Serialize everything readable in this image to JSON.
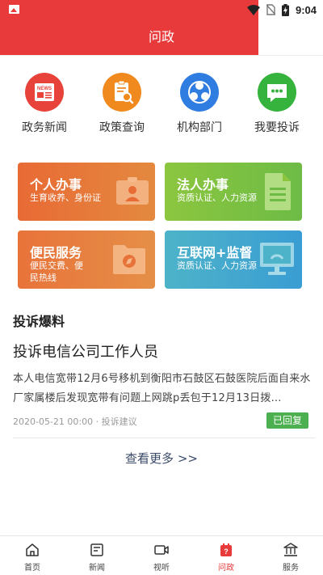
{
  "status_bar": {
    "time": "9:04"
  },
  "header": {
    "title": "问政"
  },
  "quick_links": [
    {
      "label": "政务新闻",
      "icon": "news-icon",
      "color": "#e8433b"
    },
    {
      "label": "政策查询",
      "icon": "policy-search-icon",
      "color": "#f08a1e"
    },
    {
      "label": "机构部门",
      "icon": "organization-icon",
      "color": "#2f7de1"
    },
    {
      "label": "我要投诉",
      "icon": "complaint-chat-icon",
      "color": "#35b33c"
    }
  ],
  "service_cards": [
    {
      "title": "个人办事",
      "subtitle": "生育收养、身份证",
      "icon": "id-card-icon",
      "color_start": "#e86a35",
      "color_end": "#e4893f"
    },
    {
      "title": "法人办事",
      "subtitle": "资质认证、人力资源",
      "icon": "document-icon",
      "color_start": "#8cc63f",
      "color_end": "#6dbb46"
    },
    {
      "title": "便民服务",
      "subtitle": "便民交费、便民热线",
      "icon": "folder-compass-icon",
      "color_start": "#e8733a",
      "color_end": "#e58f48"
    },
    {
      "title": "互联网+监督",
      "subtitle": "资质认证、人力资源",
      "icon": "monitor-icon",
      "color_start": "#4db3c9",
      "color_end": "#3a9dd3"
    }
  ],
  "complaints": {
    "section_title": "投诉爆料",
    "post": {
      "title": "投诉电信公司工作人员",
      "body": "本人电信宽带12月6号移机到衡阳市石鼓区石鼓医院后面自来水厂家属楼后发现宽带有问题上网跳p丢包于12月13日拨…",
      "meta": "2020-05-21 00:00 · 投诉建议",
      "status": "已回复"
    },
    "more_label": "查看更多 >>"
  },
  "bottom_nav": [
    {
      "label": "首页",
      "icon": "home-icon",
      "active": false
    },
    {
      "label": "新闻",
      "icon": "news-list-icon",
      "active": false
    },
    {
      "label": "视听",
      "icon": "video-icon",
      "active": false
    },
    {
      "label": "问政",
      "icon": "question-icon",
      "active": true
    },
    {
      "label": "服务",
      "icon": "service-bank-icon",
      "active": false
    }
  ],
  "colors": {
    "brand_red": "#e83a3a",
    "success_green": "#4cb050",
    "link_navy": "#3a4a6a"
  }
}
